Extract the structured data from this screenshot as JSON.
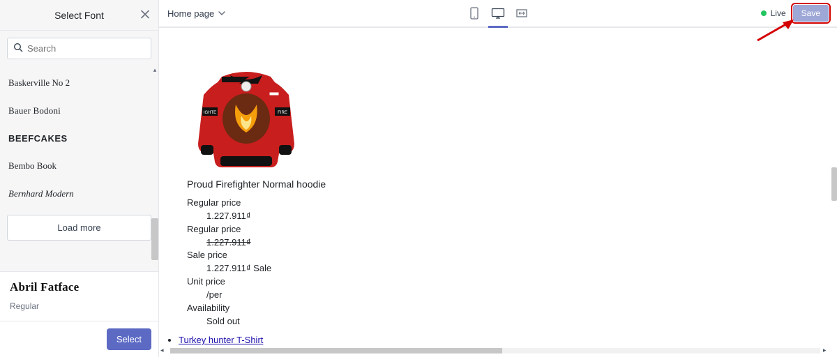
{
  "topbar": {
    "page_label": "Home page",
    "live_label": "Live",
    "save_label": "Save"
  },
  "sidebar": {
    "title": "Select Font",
    "search_placeholder": "Search",
    "fonts": [
      {
        "name": "Baskerville No 2",
        "cls": "baskerville"
      },
      {
        "name": "Bauer Bodoni",
        "cls": "bauer"
      },
      {
        "name": "Beefcakes",
        "cls": "beef"
      },
      {
        "name": "Bembo Book",
        "cls": "bembo"
      },
      {
        "name": "Bernhard Modern",
        "cls": "bernhard"
      }
    ],
    "load_more_label": "Load more",
    "selected": {
      "name": "Abril Fatface",
      "weight": "Regular"
    },
    "select_label": "Select"
  },
  "preview": {
    "product_title": "Proud Firefighter Normal hoodie",
    "labels": {
      "regular_price": "Regular price",
      "sale_price": "Sale price",
      "sale_tag": "Sale",
      "unit_price": "Unit price",
      "per": "/per",
      "availability": "Availability",
      "sold_out": "Sold out"
    },
    "prices": {
      "regular": "1.227.911₫",
      "regular_strike": "1.227.911₫",
      "sale": "1.227.911₫"
    },
    "link": {
      "label": "Turkey hunter T-Shirt"
    }
  }
}
